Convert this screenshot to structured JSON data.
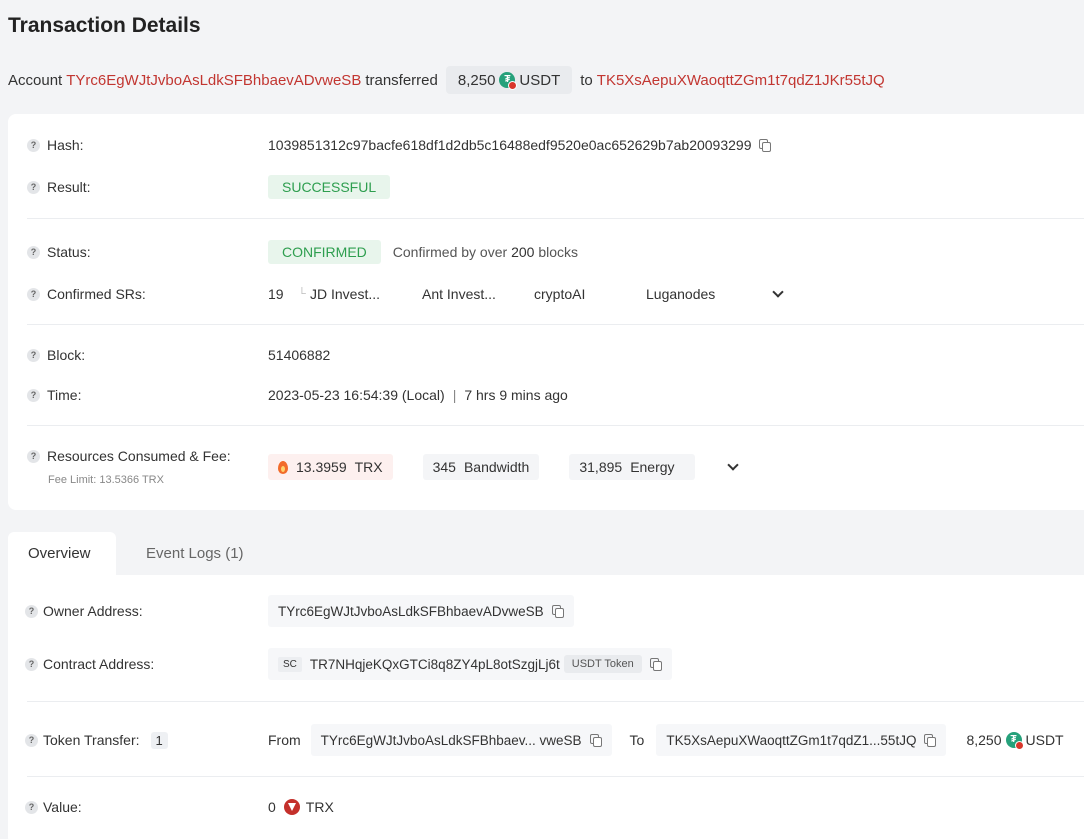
{
  "page": {
    "title": "Transaction Details"
  },
  "summary": {
    "account_label": "Account",
    "from_address": "TYrc6EgWJtJvboAsLdkSFBhbaevADvweSB",
    "transferred_label": "transferred",
    "amount": "8,250",
    "token": "USDT",
    "to_label": "to",
    "to_address": "TK5XsAepuXWaoqttZGm1t7qdZ1JKr55tJQ"
  },
  "details": {
    "hash_label": "Hash:",
    "hash": "1039851312c97bacfe618df1d2db5c16488edf9520e0ac652629b7ab20093299",
    "result_label": "Result:",
    "result": "SUCCESSFUL",
    "status_label": "Status:",
    "status": "CONFIRMED",
    "status_note_prefix": "Confirmed by over",
    "status_note_count": "200",
    "status_note_suffix": "blocks",
    "confirmed_srs_label": "Confirmed SRs:",
    "confirmed_srs_count": "19",
    "confirmed_srs": [
      "JD Invest...",
      "Ant Invest...",
      "cryptoAI",
      "Luganodes"
    ],
    "block_label": "Block:",
    "block": "51406882",
    "time_label": "Time:",
    "time": "2023-05-23 16:54:39 (Local)",
    "time_separator": "|",
    "time_ago": "7 hrs 9 mins ago",
    "resources_label": "Resources Consumed & Fee:",
    "fee_limit": "Fee Limit: 13.5366 TRX",
    "fee_trx_value": "13.3959",
    "fee_trx_unit": "TRX",
    "bandwidth_value": "345",
    "bandwidth_unit": "Bandwidth",
    "energy_value": "31,895",
    "energy_unit": "Energy"
  },
  "tabs": [
    {
      "label": "Overview",
      "active": true
    },
    {
      "label": "Event Logs (1)",
      "active": false
    }
  ],
  "overview": {
    "owner_label": "Owner Address:",
    "owner_address": "TYrc6EgWJtJvboAsLdkSFBhbaevADvweSB",
    "contract_label": "Contract Address:",
    "contract_tag": "SC",
    "contract_address": "TR7NHqjeKQxGTCi8q8ZY4pL8otSzgjLj6t",
    "contract_token_tag": "USDT Token",
    "token_transfer_label": "Token Transfer:",
    "token_transfer_count": "1",
    "from_label": "From",
    "from_address_short": "TYrc6EgWJtJvboAsLdkSFBhbaev... vweSB",
    "to_label": "To",
    "to_address_short": "TK5XsAepuXWaoqttZGm1t7qdZ1...55tJQ",
    "transfer_amount": "8,250",
    "transfer_token": "USDT",
    "value_label": "Value:",
    "value_amount": "0",
    "value_unit": "TRX"
  },
  "colors": {
    "address_red": "#c23631",
    "success_green": "#2e9e4f",
    "usdt_green": "#26a17b"
  },
  "icons": [
    "question-icon",
    "copy-icon",
    "usdt-icon",
    "trx-icon",
    "flame-icon",
    "chevron-down-icon"
  ]
}
